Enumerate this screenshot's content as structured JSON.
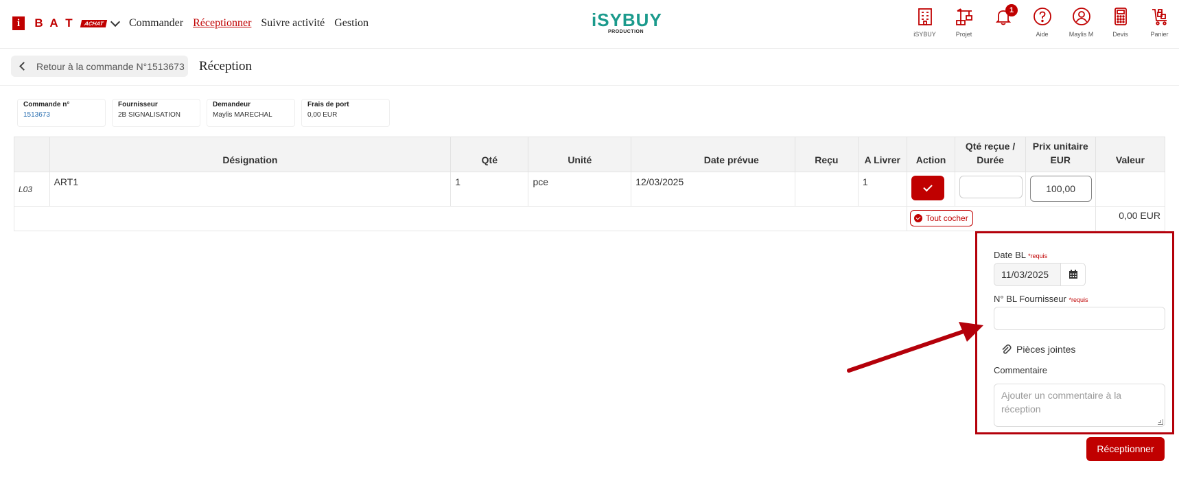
{
  "header": {
    "brand_letters": [
      "B",
      "A",
      "T"
    ],
    "brand_i": "i",
    "brand_tag": "ACHAT",
    "nav": [
      {
        "label": "Commander",
        "active": false
      },
      {
        "label": "Réceptionner",
        "active": true
      },
      {
        "label": "Suivre activité",
        "active": false
      },
      {
        "label": "Gestion",
        "active": false
      }
    ],
    "logo_main": "iSYBUY",
    "logo_sub": "PRODUCTION",
    "tools": {
      "isybuy": {
        "label": "iSYBUY",
        "icon": "building-icon"
      },
      "projet": {
        "label": "Projet",
        "icon": "crane-icon"
      },
      "notifications": {
        "label": "",
        "icon": "bell-icon",
        "badge": "1"
      },
      "aide": {
        "label": "Aide",
        "icon": "help-icon"
      },
      "user": {
        "label": "Maylis M",
        "icon": "user-icon"
      },
      "devis": {
        "label": "Devis",
        "icon": "calculator-icon"
      },
      "panier": {
        "label": "Panier",
        "icon": "cart-icon"
      }
    }
  },
  "subheader": {
    "back_label": "Retour à la commande N°1513673",
    "title": "Réception"
  },
  "info_cards": [
    {
      "label": "Commande n°",
      "value": "1513673"
    },
    {
      "label": "Fournisseur",
      "value": "2B SIGNALISATION"
    },
    {
      "label": "Demandeur",
      "value": "Maylis MARECHAL"
    },
    {
      "label": "Frais de port",
      "value": "0,00 EUR"
    }
  ],
  "table": {
    "headers": {
      "designation": "Désignation",
      "qte": "Qté",
      "unite": "Unité",
      "date_prevue": "Date prévue",
      "recu": "Reçu",
      "a_livrer": "A Livrer",
      "action": "Action",
      "qte_recue_1": "Qté reçue /",
      "qte_recue_2": "Durée",
      "prix_1": "Prix unitaire",
      "prix_2": "EUR",
      "valeur": "Valeur"
    },
    "rows": [
      {
        "code": "L03",
        "designation": "ART1",
        "qte": "1",
        "unite": "pce",
        "date_prevue": "12/03/2025",
        "recu": "",
        "a_livrer": "1",
        "qte_recue": "",
        "prix_unitaire": "100,00",
        "valeur": ""
      }
    ],
    "tout_cocher": "Tout cocher",
    "total": "0,00 EUR"
  },
  "reception_form": {
    "date_bl_label": "Date BL",
    "required_marker": "*requis",
    "date_bl_value": "11/03/2025",
    "bl_fournisseur_label": "N° BL Fournisseur",
    "bl_fournisseur_value": "",
    "pieces_jointes": "Pièces jointes",
    "commentaire_label": "Commentaire",
    "commentaire_placeholder": "Ajouter un commentaire à la réception",
    "submit_label": "Réceptionner"
  },
  "colors": {
    "brand_red": "#c00000",
    "logo_teal": "#1b9a8c",
    "annotation_red": "#b4000a"
  }
}
